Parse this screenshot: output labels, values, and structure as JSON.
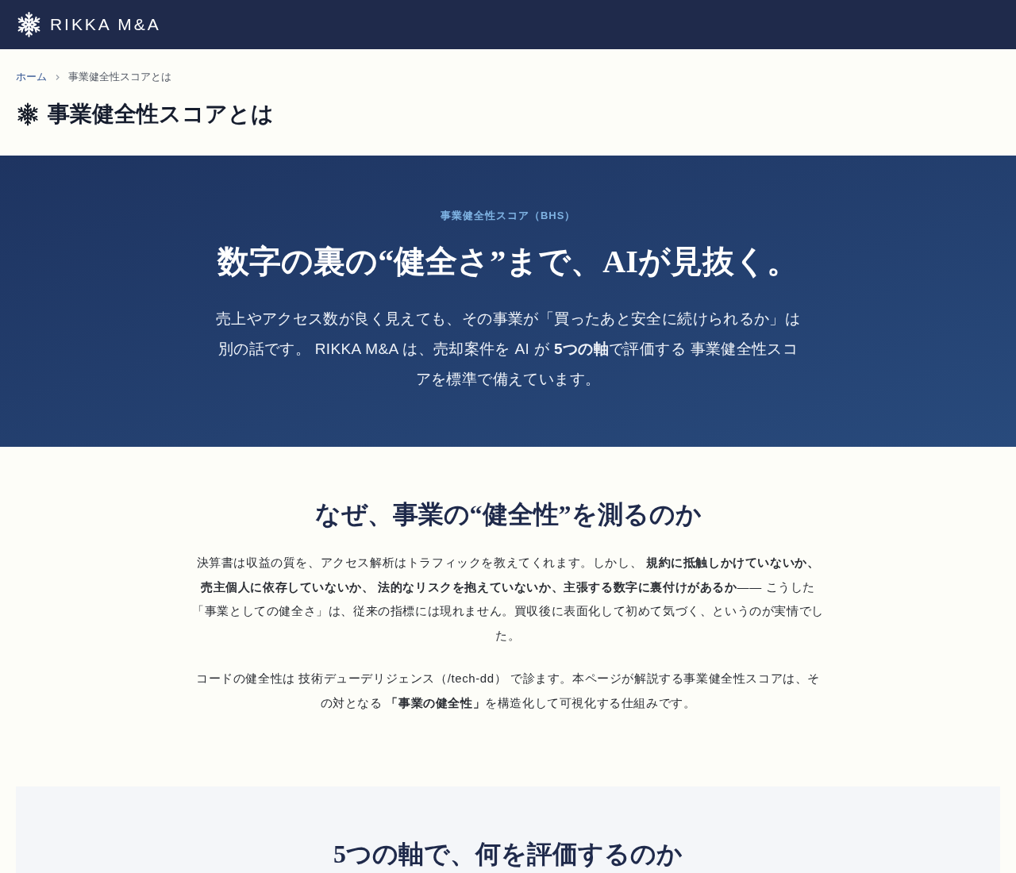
{
  "header": {
    "logo_text": "RIKKA M&A"
  },
  "breadcrumb": [
    {
      "label": "ホーム",
      "kind": "link"
    },
    {
      "label": "事業健全性スコアとは",
      "kind": "current"
    }
  ],
  "page_title": "事業健全性スコアとは",
  "hero": {
    "eyebrow": "事業健全性スコア（BHS）",
    "heading": "数字の裏の“健全さ”まで、AIが見抜く。",
    "lead": "売上やアクセス数が良く見えても、その事業が「買ったあと安全に続けられるか」は別の話です。 RIKKA M&A は、売却案件を AI が **5つの軸**で評価する 事業健全性スコアを標準で備えています。"
  },
  "why_section": {
    "heading": "なぜ、事業の“健全性”を測るのか",
    "paragraphs": [
      "決算書は収益の質を、アクセス解析はトラフィックを教えてくれます。しかし、 **規約に抵触しかけていないか、売主個人に依存していないか、 法的なリスクを抱えていないか、主張する数字に裏付けがあるか**—— こうした「事業としての健全さ」は、従来の指標には現れません。買収後に表面化して初めて気づく、というのが実情でした。",
      "コードの健全性は 技術デューデリジェンス（/tech-dd） で診ます。本ページが解説する事業健全性スコアは、その対となる **「事業の健全性」**を構造化して可視化する仕組みです。"
    ]
  },
  "axes_section": {
    "heading": "5つの軸で、何を評価するのか"
  }
}
